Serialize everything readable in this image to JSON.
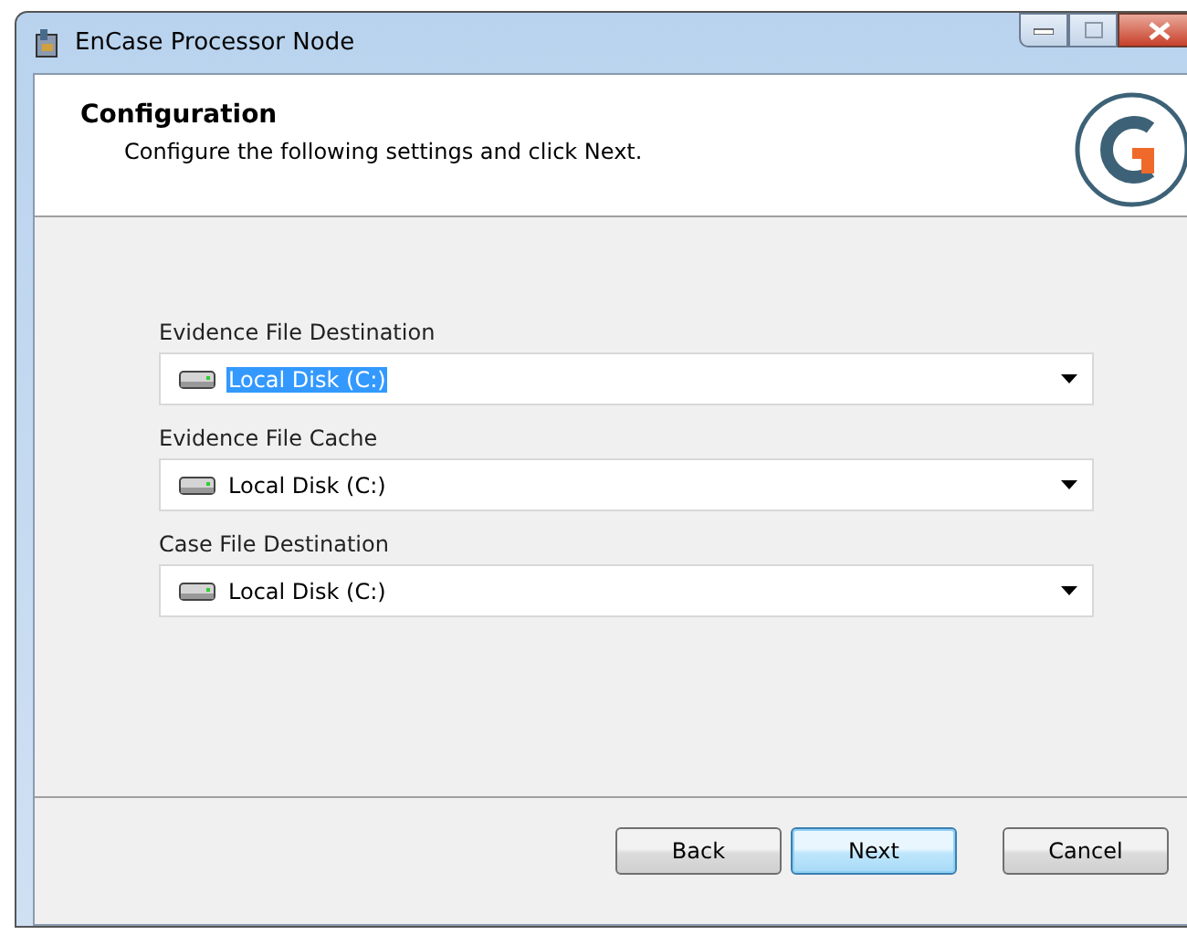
{
  "window": {
    "title": "EnCase Processor Node"
  },
  "header": {
    "title": "Configuration",
    "subtitle": "Configure the following settings and click Next."
  },
  "fields": [
    {
      "label": "Evidence File Destination",
      "value": "Local Disk (C:)",
      "focused": true
    },
    {
      "label": "Evidence File Cache",
      "value": "Local Disk (C:)",
      "focused": false
    },
    {
      "label": "Case File Destination",
      "value": "Local Disk (C:)",
      "focused": false
    }
  ],
  "buttons": [
    {
      "label": "Back",
      "default": false
    },
    {
      "label": "Next",
      "default": true
    },
    {
      "label": "Cancel",
      "default": false
    }
  ]
}
